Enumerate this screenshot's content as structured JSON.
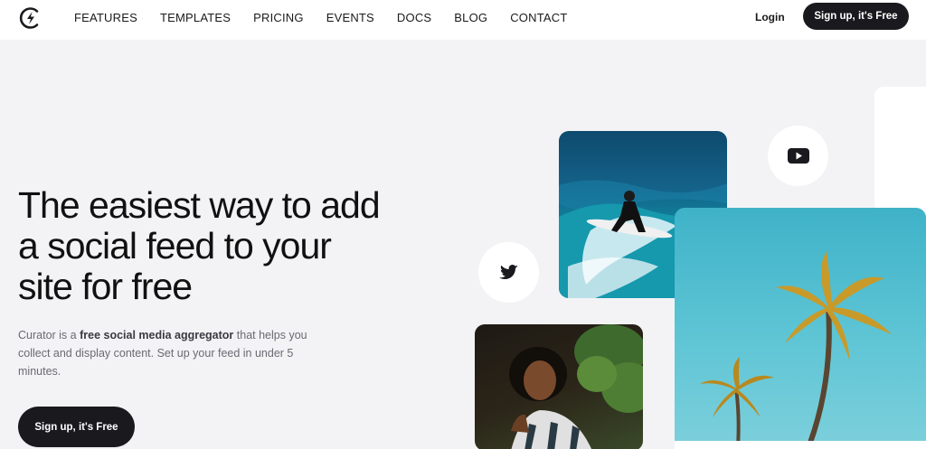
{
  "nav": {
    "logo": "curator-logo-icon",
    "links": [
      "FEATURES",
      "TEMPLATES",
      "PRICING",
      "EVENTS",
      "DOCS",
      "BLOG",
      "CONTACT"
    ],
    "login": "Login",
    "signup": "Sign up, it's Free"
  },
  "hero": {
    "headline": "The easiest way to add a social feed to your site for free",
    "desc_prefix": "Curator is a ",
    "desc_bold": "free social media aggregator",
    "desc_suffix": " that helps you collect and display content. Set up your feed in under 5 minutes.",
    "cta": "Sign up, it's Free"
  },
  "media": {
    "icons": [
      "youtube-icon",
      "twitter-icon"
    ],
    "images": [
      "surfer-image",
      "portrait-image",
      "palm-trees-image"
    ]
  },
  "colors": {
    "background": "#f3f3f5",
    "button": "#1a1a1e",
    "text": "#111111",
    "muted": "#6a6a72"
  }
}
